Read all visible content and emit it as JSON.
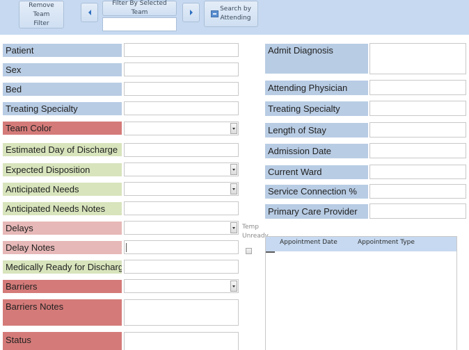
{
  "toolbar": {
    "remove_filter_label_line1": "Remove Team",
    "remove_filter_label_line2": "Filter",
    "prev_icon": "triangle-left-icon",
    "filter_label": "Filter By Selected Team",
    "filter_value": "",
    "next_icon": "triangle-right-icon",
    "search_label_line1": "Search by",
    "search_label_line2": "Attending",
    "search_icon": "form-icon"
  },
  "left_fields": [
    {
      "label": "Patient",
      "value": "",
      "type": "text",
      "color": "#b8cce4"
    },
    {
      "label": "Sex",
      "value": "",
      "type": "text",
      "color": "#b8cce4"
    },
    {
      "label": "Bed",
      "value": "",
      "type": "text",
      "color": "#b8cce4"
    },
    {
      "label": "Treating Specialty",
      "value": "",
      "type": "text",
      "color": "#b8cce4"
    },
    {
      "label": "Team Color",
      "value": "",
      "type": "combo",
      "color": "#d47b79"
    },
    {
      "label": "Estimated Day of Discharge",
      "value": "",
      "type": "text",
      "color": "#d8e4bc"
    },
    {
      "label": "Expected Disposition",
      "value": "",
      "type": "combo",
      "color": "#d8e4bc"
    },
    {
      "label": "Anticipated Needs",
      "value": "",
      "type": "combo",
      "color": "#d8e4bc"
    },
    {
      "label": "Anticipated Needs Notes",
      "value": "",
      "type": "text",
      "color": "#d8e4bc"
    },
    {
      "label": "Delays",
      "value": "",
      "type": "combo",
      "color": "#e6b8b7"
    },
    {
      "label": "Delay Notes",
      "value": "",
      "type": "text",
      "color": "#e6b8b7"
    },
    {
      "label": "Medically Ready for Discharge",
      "value": "",
      "type": "text",
      "color": "#d8e4bc"
    },
    {
      "label": "Barriers",
      "value": "",
      "type": "combo",
      "color": "#d47b79"
    },
    {
      "label": "Barriers Notes",
      "value": "",
      "type": "memo",
      "color": "#d47b79"
    },
    {
      "label": "Status",
      "value": "",
      "type": "text",
      "color": "#d47b79"
    }
  ],
  "right_fields": [
    {
      "label": "Admit Diagnosis",
      "value": ""
    },
    {
      "label": "Attending Physician",
      "value": ""
    },
    {
      "label": "Treating Specialty",
      "value": ""
    },
    {
      "label": "Length of Stay",
      "value": ""
    },
    {
      "label": "Admission Date",
      "value": ""
    },
    {
      "label": "Current Ward",
      "value": ""
    },
    {
      "label": "Service Connection %",
      "value": ""
    },
    {
      "label": "Primary Care Provider",
      "value": ""
    }
  ],
  "temp_unready": {
    "label_line1": "Temp",
    "label_line2": "Unready",
    "checked": false
  },
  "appointments": {
    "columns": [
      "Appointment Date",
      "Appointment Type"
    ],
    "rows": []
  },
  "colors": {
    "toolbar_bg": "#c6d9f0",
    "label_blue": "#b8cce4",
    "label_red": "#d47b79",
    "label_pink": "#e6b8b7",
    "label_green": "#d8e4bc"
  }
}
